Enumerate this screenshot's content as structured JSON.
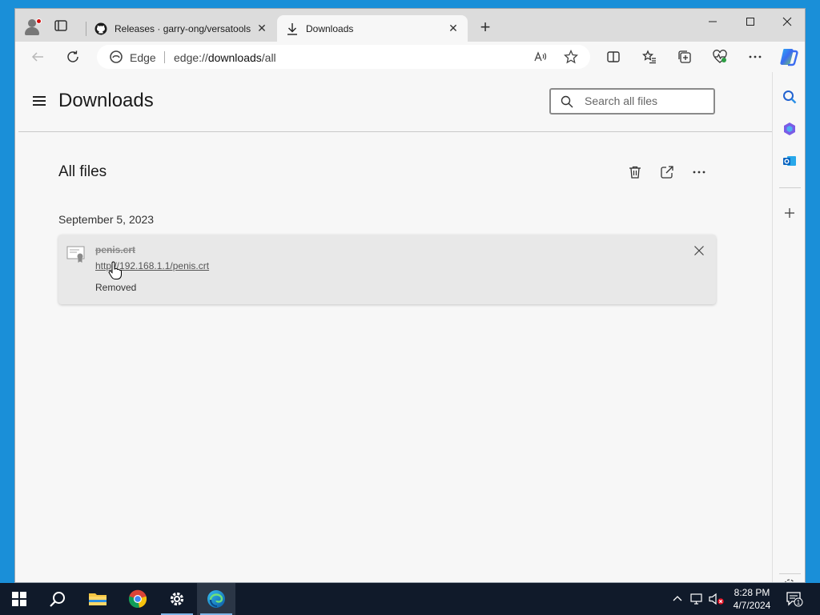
{
  "browser": {
    "tabs": [
      {
        "label": "Releases · garry-ong/versatools",
        "icon": "github-icon"
      },
      {
        "label": "Downloads",
        "icon": "download-icon",
        "active": true
      }
    ],
    "address": {
      "site_label": "Edge",
      "url_prefix": "edge://",
      "url_host": "downloads",
      "url_path": "/all"
    }
  },
  "page": {
    "title": "Downloads",
    "search_placeholder": "Search all files",
    "section_title": "All files",
    "groups": [
      {
        "date": "September 5, 2023",
        "items": [
          {
            "filename": "penis.crt",
            "url": "http://192.168.1.1/penis.crt",
            "status": "Removed"
          }
        ]
      }
    ]
  },
  "taskbar": {
    "time": "8:28 PM",
    "date": "4/7/2024",
    "notification_count": "1"
  },
  "colors": {
    "accent": "#0078d4",
    "desktop": "#1a8fd8",
    "taskbar": "#101a2a"
  }
}
